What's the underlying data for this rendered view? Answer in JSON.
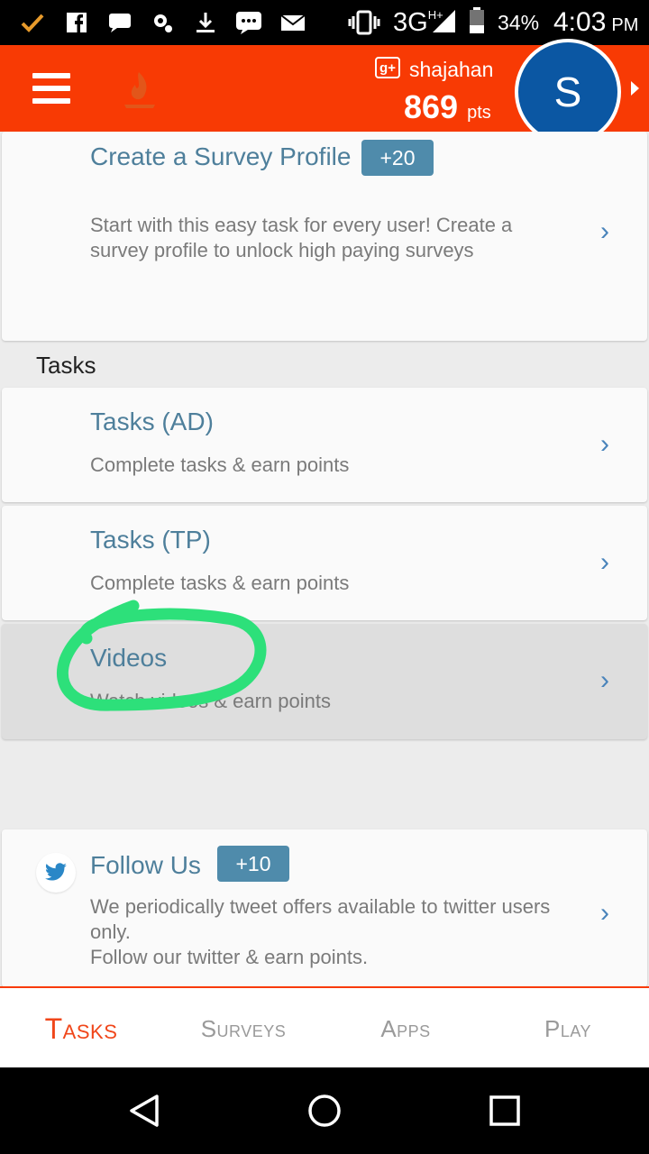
{
  "status_bar": {
    "network": "3G",
    "network_sup": "H+",
    "battery": "34%",
    "time": "4:03",
    "ampm": "PM",
    "icons": [
      "check-icon",
      "facebook-icon",
      "chat-icon",
      "settings-icon",
      "download-icon",
      "message-icon",
      "mail-icon",
      "vibrate-icon",
      "signal-icon",
      "battery-icon"
    ]
  },
  "header": {
    "gplus_label": "g+",
    "username": "shajahan",
    "points": "869",
    "points_unit": "pts",
    "avatar_letter": "S",
    "brand_color": "#f83a04"
  },
  "cards": [
    {
      "title": "Create a Survey Profile",
      "badge": "+20",
      "desc": "Start with this easy task for every user! Create a survey profile to unlock high paying surveys"
    },
    {
      "title": "Tasks (AD)",
      "desc": "Complete tasks & earn points"
    },
    {
      "title": "Tasks (TP)",
      "desc": "Complete tasks & earn points"
    },
    {
      "title": "Videos",
      "desc": "Watch videos & earn points"
    },
    {
      "title": "Follow Us",
      "badge": "+10",
      "desc": "We periodically tweet offers available to twitter users only.",
      "desc2": "Follow our twitter & earn points."
    }
  ],
  "section_title": "Tasks",
  "tabs": [
    "Tasks",
    "Surveys",
    "Apps",
    "Play"
  ],
  "active_tab": "Tasks",
  "nav": [
    "back-icon",
    "home-icon",
    "recents-icon"
  ],
  "annotation_color": "#2de07a"
}
